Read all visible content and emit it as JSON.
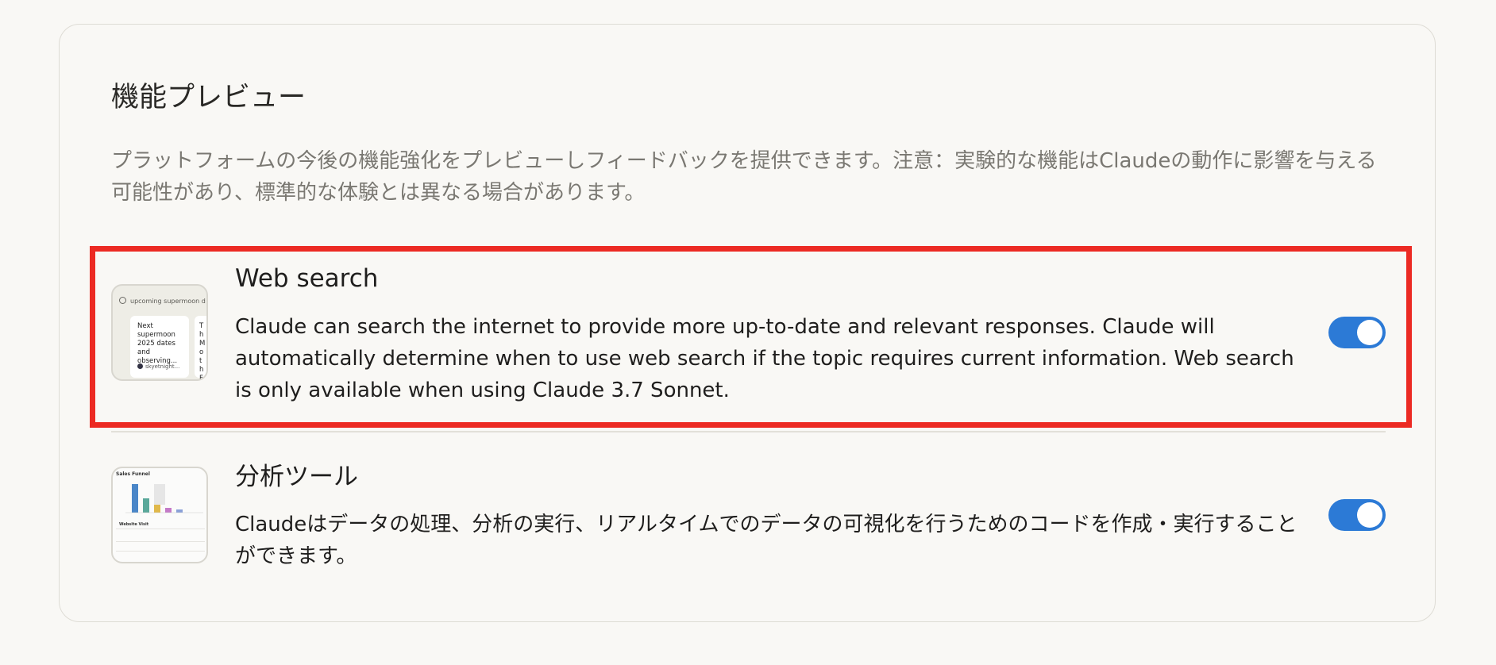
{
  "section": {
    "title": "機能プレビュー",
    "description": "プラットフォームの今後の機能強化をプレビューしフィードバックを提供できます。注意：実験的な機能はClaudeの動作に影響を与える可能性があり、標準的な体験とは異なる場合があります。"
  },
  "features": [
    {
      "title": "Web search",
      "description": "Claude can search the internet to provide more up-to-date and relevant responses. Claude will automatically determine when to use web search if the topic requires current information. Web search is only available when using Claude 3.7 Sonnet.",
      "enabled": true,
      "thumbnail": {
        "query": "upcoming supermoon d",
        "card1_text": "Next supermoon 2025 dates and observing...",
        "card1_source": "skyetnight...",
        "card2_text": "Th Mo th Fa"
      }
    },
    {
      "title": "分析ツール",
      "description": "Claudeはデータの処理、分析の実行、リアルタイムでのデータの可視化を行うためのコードを作成・実行することができます。",
      "enabled": true,
      "thumbnail": {
        "heading": "Sales Funnel",
        "subheading": "Website Visit"
      }
    }
  ],
  "colors": {
    "toggle_on": "#2c7ad6",
    "highlight": "#ec2a23",
    "background": "#f9f8f5"
  }
}
